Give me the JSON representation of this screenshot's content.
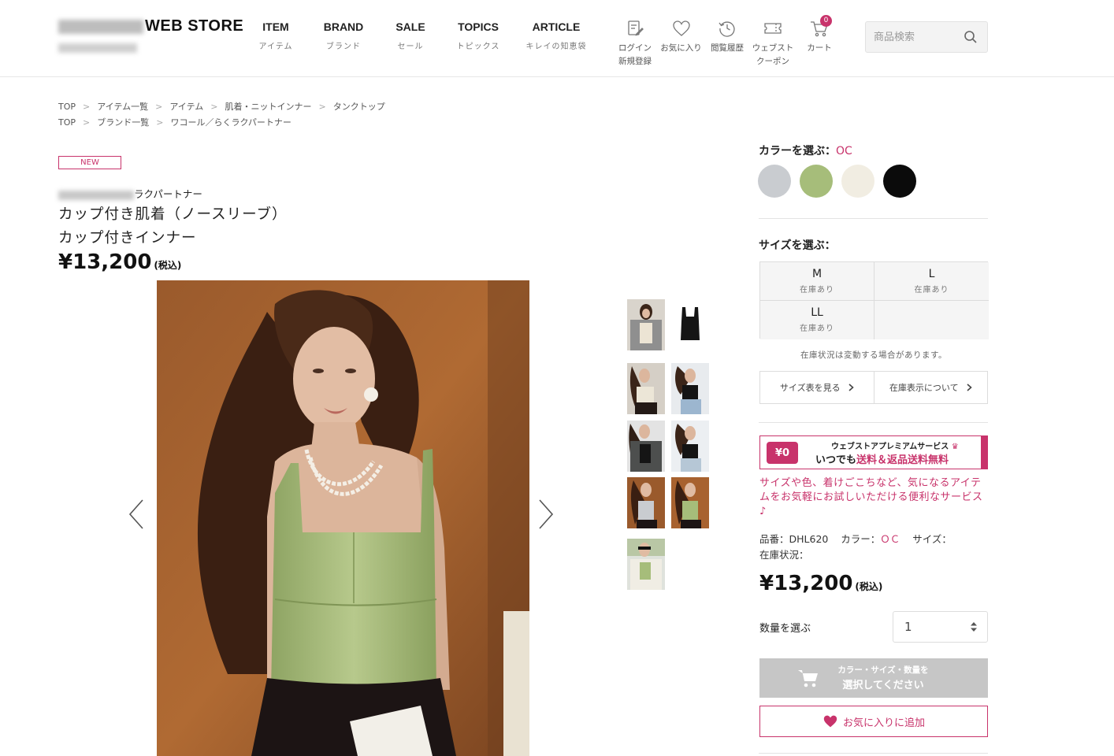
{
  "header": {
    "logo": "WEB STORE",
    "nav": [
      {
        "en": "ITEM",
        "jp": "アイテム"
      },
      {
        "en": "BRAND",
        "jp": "ブランド"
      },
      {
        "en": "SALE",
        "jp": "セール"
      },
      {
        "en": "TOPICS",
        "jp": "トピックス"
      },
      {
        "en": "ARTICLE",
        "jp": "キレイの知恵袋"
      }
    ],
    "utilities": [
      {
        "icon": "login-icon",
        "line1": "ログイン",
        "line2": "新規登録"
      },
      {
        "icon": "heart-icon",
        "line1": "お気に入り",
        "line2": ""
      },
      {
        "icon": "history-icon",
        "line1": "閲覧履歴",
        "line2": ""
      },
      {
        "icon": "coupon-icon",
        "line1": "ウェブスト",
        "line2": "クーポン"
      },
      {
        "icon": "cart-icon",
        "line1": "カート",
        "line2": ""
      }
    ],
    "cart_count": "0",
    "search_placeholder": "商品検索"
  },
  "breadcrumbs": [
    [
      "TOP",
      "アイテム一覧",
      "アイテム",
      "肌着・ニットインナー",
      "タンクトップ"
    ],
    [
      "TOP",
      "ブランド一覧",
      "ワコール／らくラクパートナー"
    ]
  ],
  "product": {
    "badge": "NEW",
    "brand_suffix": "ラクパートナー",
    "title": "カップ付き肌着（ノースリーブ）",
    "subtitle": "カップ付きインナー",
    "price": "¥13,200",
    "tax_label": "(税込)",
    "code": "DHL620",
    "color_code": "OC"
  },
  "options": {
    "color_label": "カラーを選ぶ：",
    "selected_color": "OC",
    "colors": [
      "#c9ccd0",
      "#a6bd7a",
      "#f1ede2",
      "#0b0b0b"
    ],
    "size_label": "サイズを選ぶ：",
    "sizes": [
      {
        "name": "M",
        "stock": "在庫あり"
      },
      {
        "name": "L",
        "stock": "在庫あり"
      },
      {
        "name": "LL",
        "stock": "在庫あり"
      }
    ],
    "stock_note": "在庫状況は変動する場合があります。",
    "size_chart_link": "サイズ表を見る",
    "stock_display_link": "在庫表示について"
  },
  "premium": {
    "badge": "¥0",
    "title": "ウェブストアプレミアムサービス",
    "line_prefix": "いつでも",
    "line_highlight": "送料＆返品送料無料",
    "description": "サイズや色、着けごこちなど、気になるアイテムをお気軽にお試しいただける便利なサービス♪"
  },
  "spec": {
    "code_label": "品番：",
    "code": "DHL620",
    "color_label": "カラー：",
    "color": "ＯＣ",
    "size_label": "サイズ：",
    "stock_label": "在庫状況："
  },
  "purchase": {
    "price": "¥13,200",
    "tax_label": "(税込)",
    "qty_label": "数量を選ぶ",
    "qty_value": "1",
    "cart_line1": "カラー・サイズ・数量を",
    "cart_line2": "選択してください",
    "fav_label": "お気に入りに追加"
  },
  "colors": {
    "accent": "#c8336b",
    "disabled": "#c6c6c6"
  }
}
